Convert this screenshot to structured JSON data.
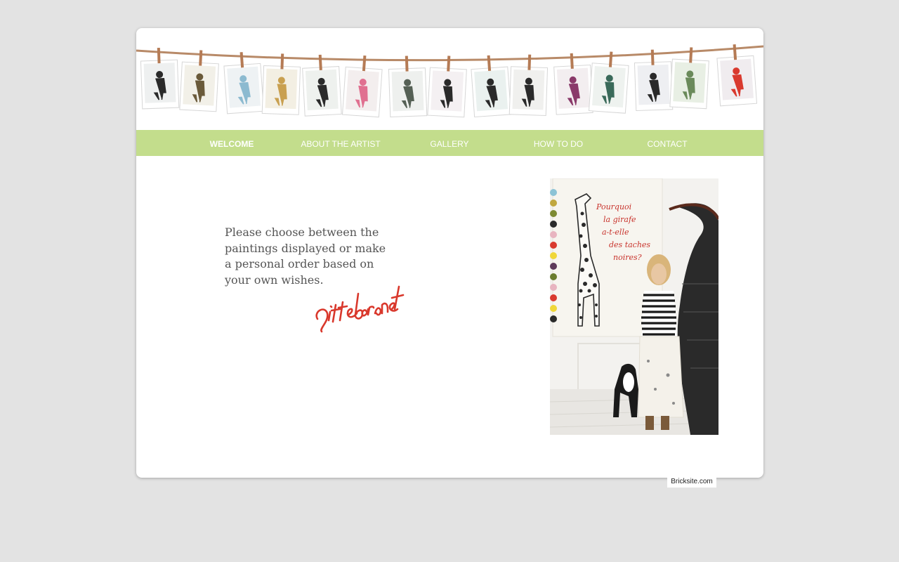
{
  "nav": {
    "items": [
      {
        "label": "WELCOME",
        "active": true
      },
      {
        "label": "ABOUT THE ARTIST",
        "active": false
      },
      {
        "label": "GALLERY",
        "active": false
      },
      {
        "label": "HOW TO DO",
        "active": false
      },
      {
        "label": "CONTACT",
        "active": false
      }
    ]
  },
  "welcome": {
    "lines": [
      "Please choose between the",
      "paintings displayed or make",
      "a personal order based on",
      "your own wishes."
    ],
    "signature": "gittebrandt"
  },
  "photo": {
    "painting_text": [
      "Pourquoi",
      "la girafe",
      "a-t-elle",
      "des taches",
      "noires?"
    ]
  },
  "footer": {
    "credit": "Bricksite.com"
  },
  "colors": {
    "page_bg": "#e3e3e3",
    "nav_bg": "#c3dd8c",
    "signature": "#d9382c"
  }
}
